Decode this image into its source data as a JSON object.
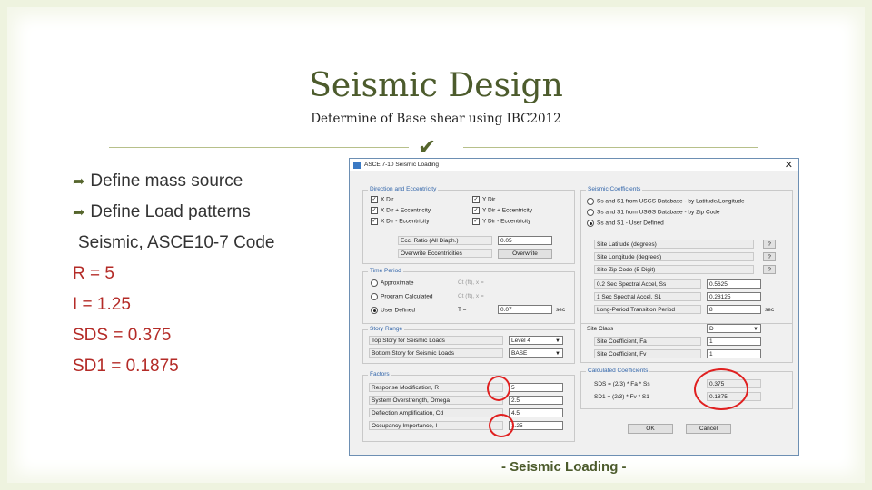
{
  "slide": {
    "title": "Seismic Design",
    "subtitle": "Determine of Base shear using IBC2012",
    "bullets": [
      "Define mass source",
      "Define Load patterns"
    ],
    "plain_line": "Seismic, ASCE10-7 Code",
    "values": [
      "R = 5",
      "I = 1.25",
      "SDS = 0.375",
      "SD1 = 0.1875"
    ],
    "footer": "- Seismic Loading -"
  },
  "colors": {
    "accent": "#4c5b2c",
    "value_red": "#b42b27",
    "highlight_circle": "#e02020"
  },
  "dialog": {
    "title": "ASCE 7-10 Seismic Loading",
    "close": "✕",
    "direction": {
      "label": "Direction and Eccentricity",
      "checks": [
        {
          "text": "X Dir",
          "checked": true
        },
        {
          "text": "Y Dir",
          "checked": true
        },
        {
          "text": "X Dir + Eccentricity",
          "checked": true
        },
        {
          "text": "Y Dir + Eccentricity",
          "checked": true
        },
        {
          "text": "X Dir - Eccentricity",
          "checked": true
        },
        {
          "text": "Y Dir - Eccentricity",
          "checked": true
        }
      ],
      "ecc_label": "Ecc. Ratio (All Diaph.)",
      "ecc_value": "0.05",
      "overwrite_label": "Overwrite Eccentricities",
      "overwrite_button": "Overwrite"
    },
    "time_period": {
      "label": "Time Period",
      "options": [
        "Approximate",
        "Program Calculated",
        "User Defined"
      ],
      "ct_labels": [
        "Ct (ft), x =",
        "Ct (ft), x =",
        "T ="
      ],
      "t_value": "0.07",
      "unit": "sec"
    },
    "story_range": {
      "label": "Story Range",
      "top_label": "Top Story for Seismic Loads",
      "top_value": "Level 4",
      "bottom_label": "Bottom Story for Seismic Loads",
      "bottom_value": "BASE"
    },
    "factors": {
      "label": "Factors",
      "rows": [
        {
          "label": "Response Modification, R",
          "value": "5"
        },
        {
          "label": "System Overstrength, Omega",
          "value": "2.5"
        },
        {
          "label": "Deflection Amplification, Cd",
          "value": "4.5"
        },
        {
          "label": "Occupancy Importance, I",
          "value": "1.25"
        }
      ]
    },
    "seismic_coeffs": {
      "label": "Seismic Coefficients",
      "options": [
        "Ss and S1 from USGS Database - by Latitude/Longitude",
        "Ss and S1 from USGS Database - by Zip Code",
        "Ss and S1 - User Defined"
      ],
      "selected_index": 2,
      "geo_rows": [
        "Site Latitude (degrees)",
        "Site Longitude (degrees)",
        "Site Zip Code (5-Digit)"
      ],
      "help": "?",
      "param_rows": [
        {
          "label": "0.2 Sec Spectral Accel, Ss",
          "value": "0.5625"
        },
        {
          "label": "1 Sec Spectral Accel, S1",
          "value": "0.28125"
        },
        {
          "label": "Long-Period Transition Period",
          "value": "8"
        }
      ],
      "site_class_label": "Site Class",
      "site_class_value": "D",
      "fa_label": "Site Coefficient, Fa",
      "fa_value": "1",
      "fv_label": "Site Coefficient, Fv",
      "fv_value": "1",
      "calc_label": "Calculated Coefficients",
      "sds_label": "SDS = (2/3) * Fa * Ss",
      "sds_value": "0.375",
      "sd1_label": "SD1 = (2/3) * Fv * S1",
      "sd1_value": "0.1875",
      "unit": "sec"
    },
    "ok": "OK",
    "cancel": "Cancel"
  }
}
